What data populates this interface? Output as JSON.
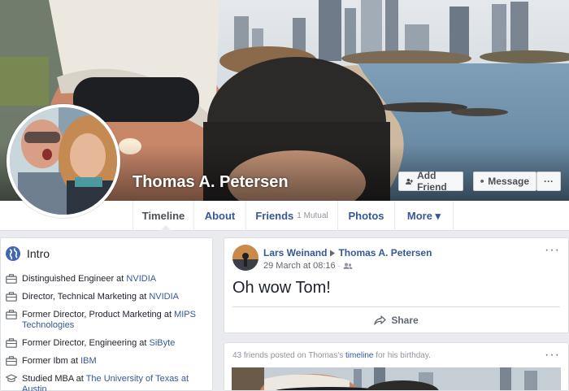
{
  "profile": {
    "name": "Thomas A. Petersen",
    "buttons": {
      "add_friend": "Add Friend",
      "message": "Message",
      "more": "···"
    }
  },
  "nav": {
    "tabs": [
      {
        "label": "Timeline",
        "sub": ""
      },
      {
        "label": "About",
        "sub": ""
      },
      {
        "label": "Friends",
        "sub": "1 Mutual"
      },
      {
        "label": "Photos",
        "sub": ""
      },
      {
        "label": "More ▾",
        "sub": ""
      }
    ]
  },
  "intro": {
    "title": "Intro",
    "items": [
      {
        "prefix": "Distinguished Engineer at ",
        "link": "NVIDIA",
        "icon": "briefcase-icon"
      },
      {
        "prefix": "Director, Technical Marketing at ",
        "link": "NVIDIA",
        "icon": "briefcase-icon"
      },
      {
        "prefix": "Former Director, Product Marketing at ",
        "link": "MIPS Technologies",
        "icon": "briefcase-icon"
      },
      {
        "prefix": "Former Director, Engineering at ",
        "link": "SiByte",
        "icon": "briefcase-icon"
      },
      {
        "prefix": "Former Ibm at ",
        "link": "IBM",
        "icon": "briefcase-icon"
      },
      {
        "prefix": "Studied MBA at ",
        "link": "The University of Texas at Austin",
        "icon": "graduation-cap-icon"
      }
    ]
  },
  "post": {
    "author": "Lars Weinand",
    "target": "Thomas A. Petersen",
    "timestamp": "29 March at 08:16",
    "text": "Oh wow Tom!",
    "share_label": "Share",
    "menu": "···"
  },
  "birthday": {
    "prefix": "43 friends posted on Thomas's ",
    "link": "timeline",
    "suffix": " for his birthday.",
    "menu": "···"
  },
  "colors": {
    "link": "#365899",
    "background": "#e9ebee",
    "card": "#ffffff"
  }
}
